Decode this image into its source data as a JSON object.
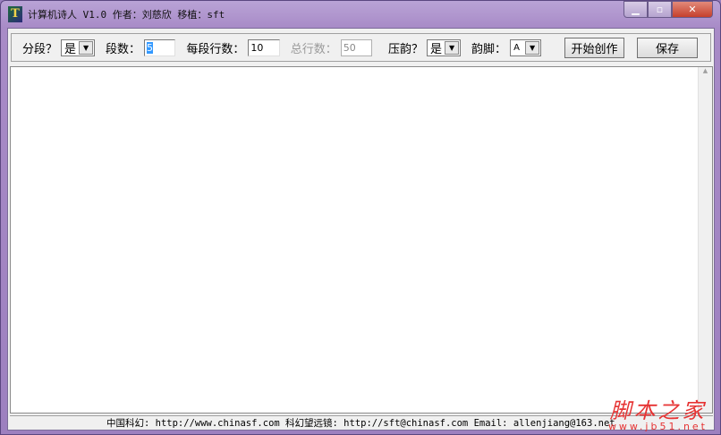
{
  "window": {
    "title": "计算机诗人 V1.0 作者：刘慈欣 移植：sft",
    "icon_letter": "T"
  },
  "toolbar": {
    "segment_label": "分段？",
    "segment_value": "是",
    "segments_label": "段数：",
    "segments_value": "5",
    "lines_per_segment_label": "每段行数：",
    "lines_per_segment_value": "10",
    "total_lines_label": "总行数：",
    "total_lines_value": "50",
    "rhyme_label": "压韵？",
    "rhyme_value": "是",
    "rhyme_foot_label": "韵脚：",
    "rhyme_foot_value": "A",
    "start_button": "开始创作",
    "save_button": "保存"
  },
  "editor": {
    "content": ""
  },
  "status": "中国科幻: http://www.chinasf.com  科幻望远镜: http://sft@chinasf.com  Email: allenjiang@163.net",
  "watermark": {
    "title": "脚本之家",
    "url": "www.jb51.net"
  }
}
